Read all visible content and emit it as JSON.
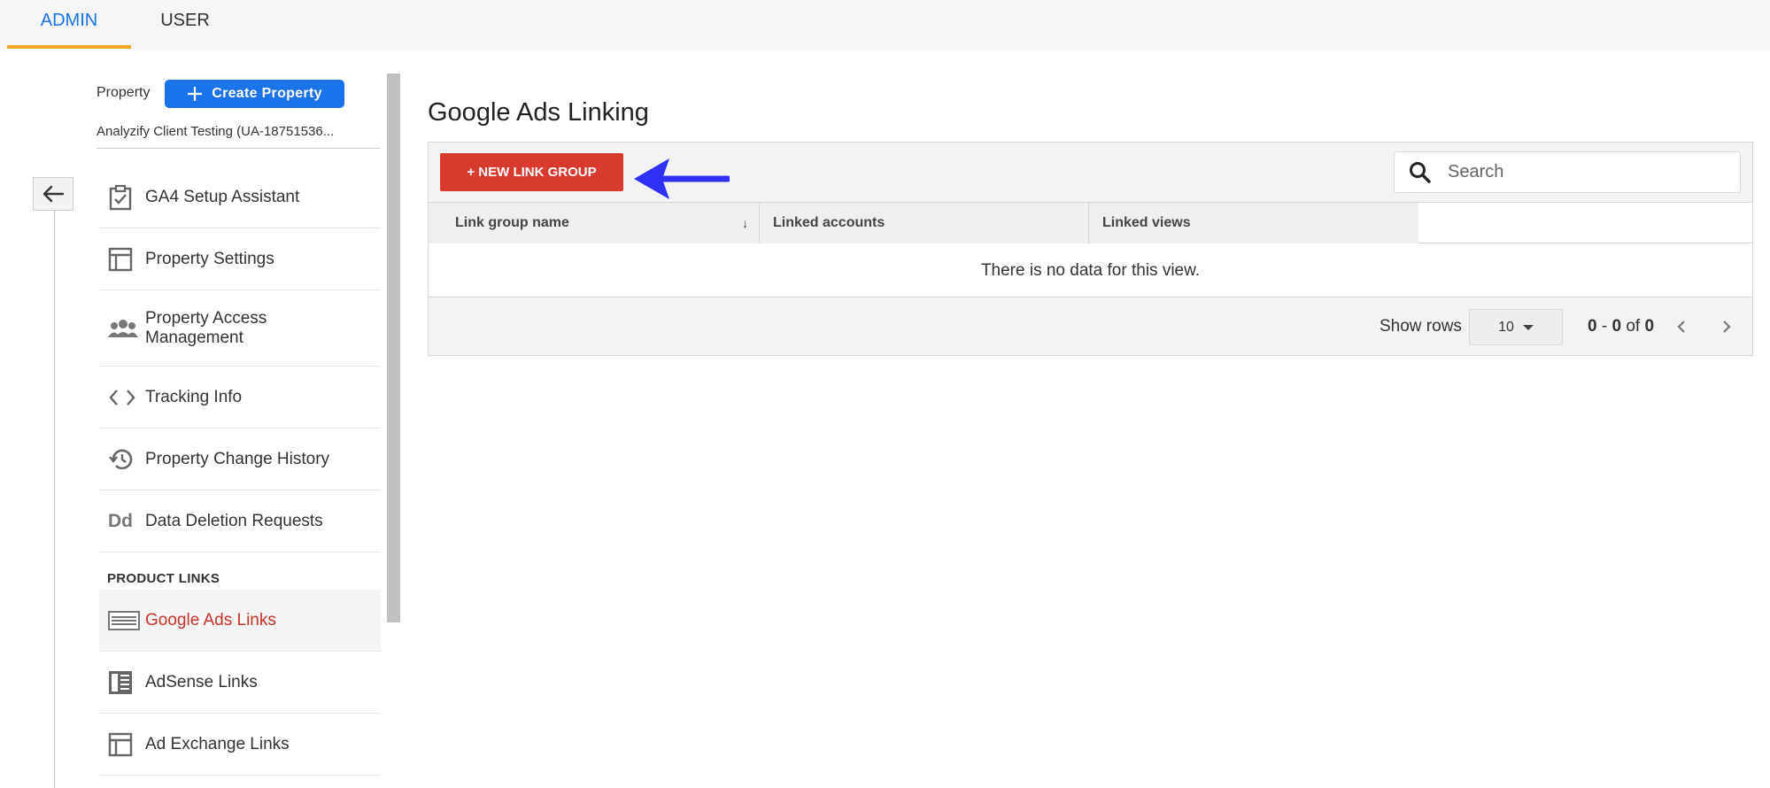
{
  "tabs": [
    {
      "label": "ADMIN",
      "active": true
    },
    {
      "label": "USER",
      "active": false
    }
  ],
  "property": {
    "label": "Property",
    "create_button": "Create Property",
    "selected": "Analyzify Client Testing (UA-18751536..."
  },
  "nav": {
    "items": [
      {
        "label": "GA4 Setup Assistant",
        "icon": "clipboard-check-icon"
      },
      {
        "label": "Property Settings",
        "icon": "layout-icon"
      },
      {
        "label": "Property Access Management",
        "icon": "people-icon"
      },
      {
        "label": "Tracking Info",
        "icon": "code-icon"
      },
      {
        "label": "Property Change History",
        "icon": "history-icon"
      },
      {
        "label": "Data Deletion Requests",
        "icon": "dd-icon"
      }
    ],
    "section_heading": "PRODUCT LINKS",
    "product_links": [
      {
        "label": "Google Ads Links",
        "icon": "ads-links-icon",
        "active": true
      },
      {
        "label": "AdSense Links",
        "icon": "adsense-icon",
        "active": false
      },
      {
        "label": "Ad Exchange Links",
        "icon": "layout-icon",
        "active": false
      }
    ]
  },
  "main": {
    "title": "Google Ads Linking",
    "new_link_button": "+ NEW LINK GROUP",
    "search_placeholder": "Search",
    "columns": [
      "Link group name",
      "Linked accounts",
      "Linked views"
    ],
    "empty_message": "There is no data for this view.",
    "show_rows_label": "Show rows",
    "rows_per_page": "10",
    "range": {
      "start": "0",
      "sep": "-",
      "end": "0",
      "of": "of",
      "total": "0"
    }
  },
  "colors": {
    "accent_blue": "#1a73e8",
    "tab_underline": "#f6a623",
    "new_link_red": "#d93a2b",
    "active_link_red": "#c5332a",
    "annotation_arrow": "#2f2ff5"
  }
}
